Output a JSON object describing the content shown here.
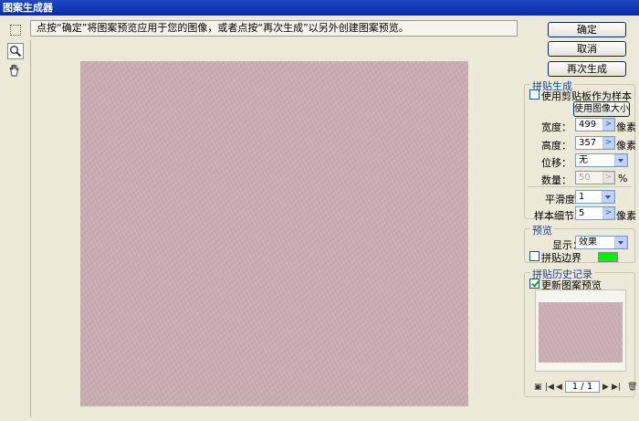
{
  "window": {
    "title": "图案生成器"
  },
  "hint": "点按“确定”将图案预览应用于您的图像，或者点按“再次生成”以另外创建图案预览。",
  "buttons": {
    "ok": "确定",
    "cancel": "取消",
    "regenerate": "再次生成"
  },
  "tile_generation": {
    "title": "拼贴生成",
    "use_clipboard_label": "使用剪贴板作为样本",
    "use_clipboard_checked": false,
    "use_image_size_label": "使用图像大小",
    "width_label": "宽度：",
    "width_value": "499",
    "height_label": "高度：",
    "height_value": "357",
    "unit_pixels": "像素",
    "offset_label": "位移：",
    "offset_value": "无",
    "amount_label": "数量：",
    "amount_value": "50",
    "amount_unit": "%",
    "smoothness_label": "平滑度：",
    "smoothness_value": "1",
    "sample_detail_label": "样本细节：",
    "sample_detail_value": "5",
    "sample_unit": "像素"
  },
  "preview": {
    "title": "预览",
    "show_label": "显示：",
    "show_value": "效果",
    "tile_boundaries_label": "拼贴边界",
    "tile_boundaries_checked": false,
    "boundary_color": "#00f000"
  },
  "history": {
    "title": "拼贴历史记录",
    "update_label": "更新图案预览",
    "update_checked": true,
    "pager": "1 / 1"
  },
  "colors": {
    "preview_fill": "#c7adb1",
    "title_bar": "#0a2aa8"
  }
}
